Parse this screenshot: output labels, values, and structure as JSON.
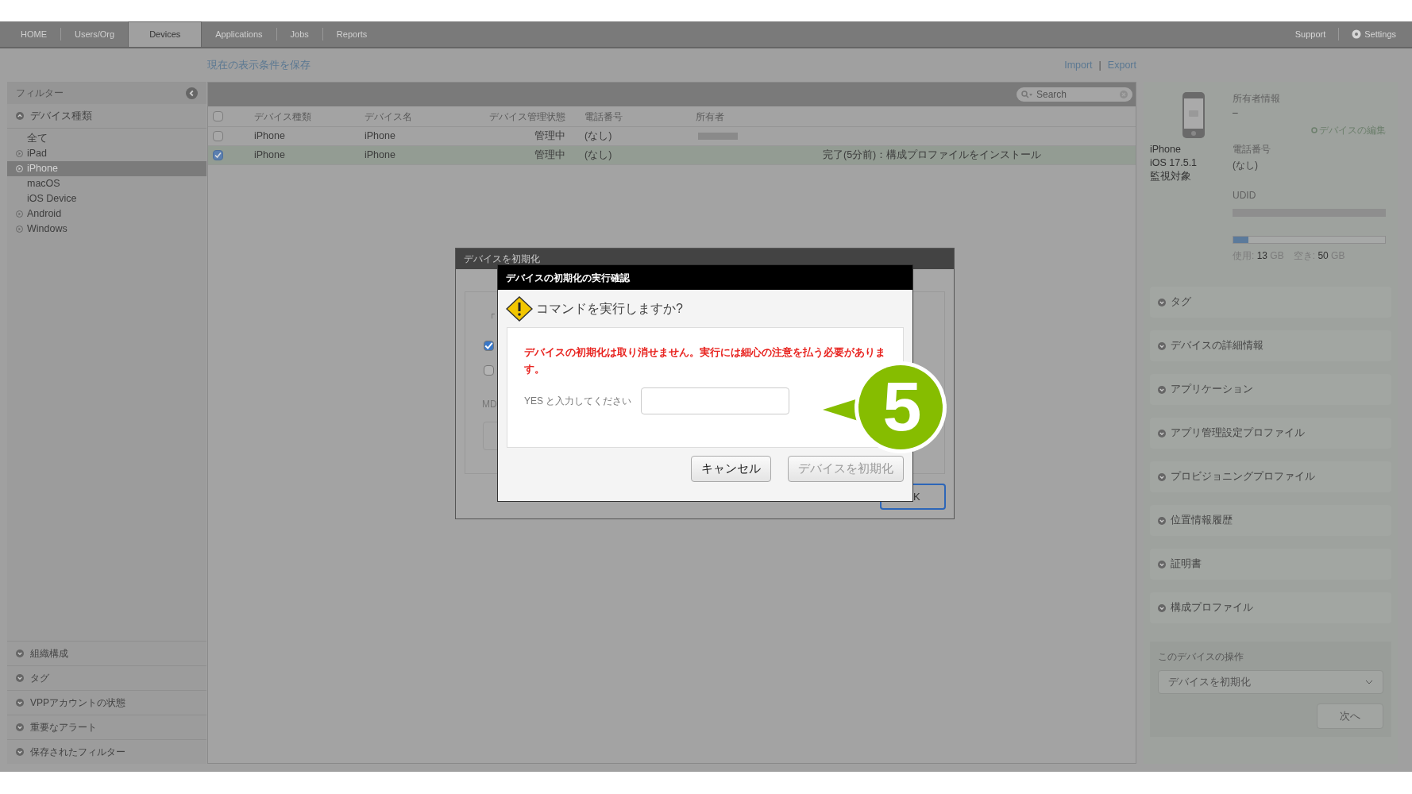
{
  "nav": {
    "tabs": [
      {
        "label": "HOME",
        "selected": false
      },
      {
        "label": "Users/Org",
        "selected": false
      },
      {
        "label": "Devices",
        "selected": true
      },
      {
        "label": "Applications",
        "selected": false
      },
      {
        "label": "Jobs",
        "selected": false
      },
      {
        "label": "Reports",
        "selected": false
      }
    ],
    "support": "Support",
    "settings": "Settings"
  },
  "toolbar": {
    "save_view": "現在の表示条件を保存",
    "import": "Import",
    "separator": "|",
    "export": "Export"
  },
  "sidebar": {
    "title": "フィルター",
    "section": "デバイス種類",
    "items": [
      {
        "label": "全て",
        "kind": "plain",
        "selected": false
      },
      {
        "label": "iPad",
        "kind": "expandable",
        "selected": false
      },
      {
        "label": "iPhone",
        "kind": "expandable",
        "selected": true
      },
      {
        "label": "macOS",
        "kind": "plain",
        "selected": false
      },
      {
        "label": "iOS Device",
        "kind": "plain",
        "selected": false
      },
      {
        "label": "Android",
        "kind": "expandable",
        "selected": false
      },
      {
        "label": "Windows",
        "kind": "expandable",
        "selected": false
      }
    ],
    "bottom_sections": [
      "組織構成",
      "タグ",
      "VPPアカウントの状態",
      "重要なアラート",
      "保存されたフィルター"
    ]
  },
  "table": {
    "search": {
      "placeholder": "Search"
    },
    "select_all": {
      "checked": false
    },
    "columns": [
      "デバイス種類",
      "デバイス名",
      "デバイス管理状態",
      "電話番号",
      "所有者"
    ],
    "rows": [
      {
        "checked": false,
        "selected": false,
        "type": "iPhone",
        "name": "iPhone",
        "state": "管理中",
        "phone": "(なし)",
        "owner_hidden": true,
        "column_7": ""
      },
      {
        "checked": true,
        "selected": true,
        "type": "iPhone",
        "name": "iPhone",
        "state": "管理中",
        "phone": "(なし)",
        "owner_hidden": false,
        "column_7": "完了(5分前)：構成プロファイルをインストール"
      }
    ]
  },
  "device": {
    "lines": [
      "iPhone",
      "iOS 17.5.1",
      "監視対象"
    ],
    "owner_label": "所有者情報",
    "owner": "–",
    "edit": "デバイスの編集",
    "phone_label": "電話番号",
    "phone": "(なし)",
    "udid_label": "UDID",
    "storage": {
      "level": 0.1,
      "reading": "使用: **13** GB　空き: **50** GB"
    },
    "sections": [
      "タグ",
      "デバイスの詳細情報",
      "アプリケーション",
      "アプリ管理設定プロファイル",
      "プロビジョニングプロファイル",
      "位置情報履歴",
      "証明書",
      "構成プロファイル"
    ],
    "operations": {
      "title": "このデバイスの操作",
      "select": "デバイスを初期化",
      "next": "次へ"
    }
  },
  "back_dialog": {
    "title": "デバイスを初期化",
    "fragment": "「",
    "checkboxes": [
      {
        "checked": true
      },
      {
        "checked": false
      }
    ],
    "label_fragment": "MD",
    "button_fragment": "K"
  },
  "dialog": {
    "title": "デバイスの初期化の実行確認",
    "question": "コマンドを実行しますか?",
    "warning": "デバイスの初期化は取り消せません。実行には細心の注意を払う必要があります。",
    "prompt": "YES と入力してください",
    "buttons": [
      {
        "label": "キャンセル",
        "disabled": false
      },
      {
        "label": "デバイスを初期化",
        "disabled": true
      }
    ]
  },
  "callout": "5"
}
